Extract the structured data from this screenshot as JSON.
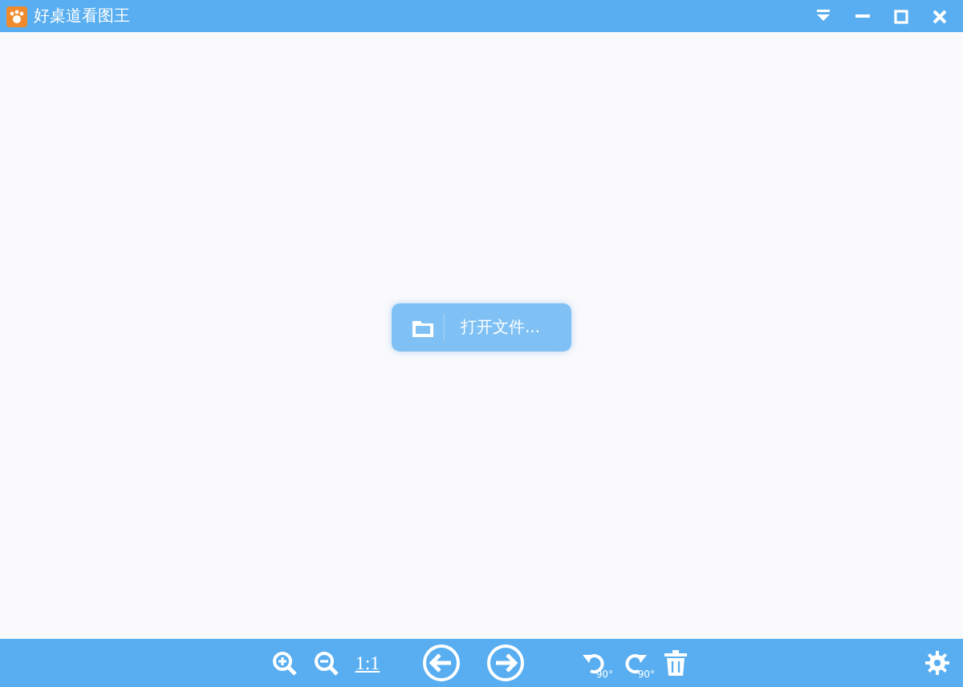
{
  "window": {
    "title": "好桌道看图王"
  },
  "open_button": {
    "label": "打开文件..."
  },
  "toolbar": {
    "items": [
      {
        "kind": "zoom-in"
      },
      {
        "kind": "zoom-out"
      },
      {
        "kind": "actual-size",
        "label": "1:1"
      },
      {
        "kind": "prev"
      },
      {
        "kind": "next"
      },
      {
        "kind": "rotate-left",
        "label": "90°"
      },
      {
        "kind": "rotate-right",
        "label": "90°"
      },
      {
        "kind": "delete"
      }
    ]
  }
}
